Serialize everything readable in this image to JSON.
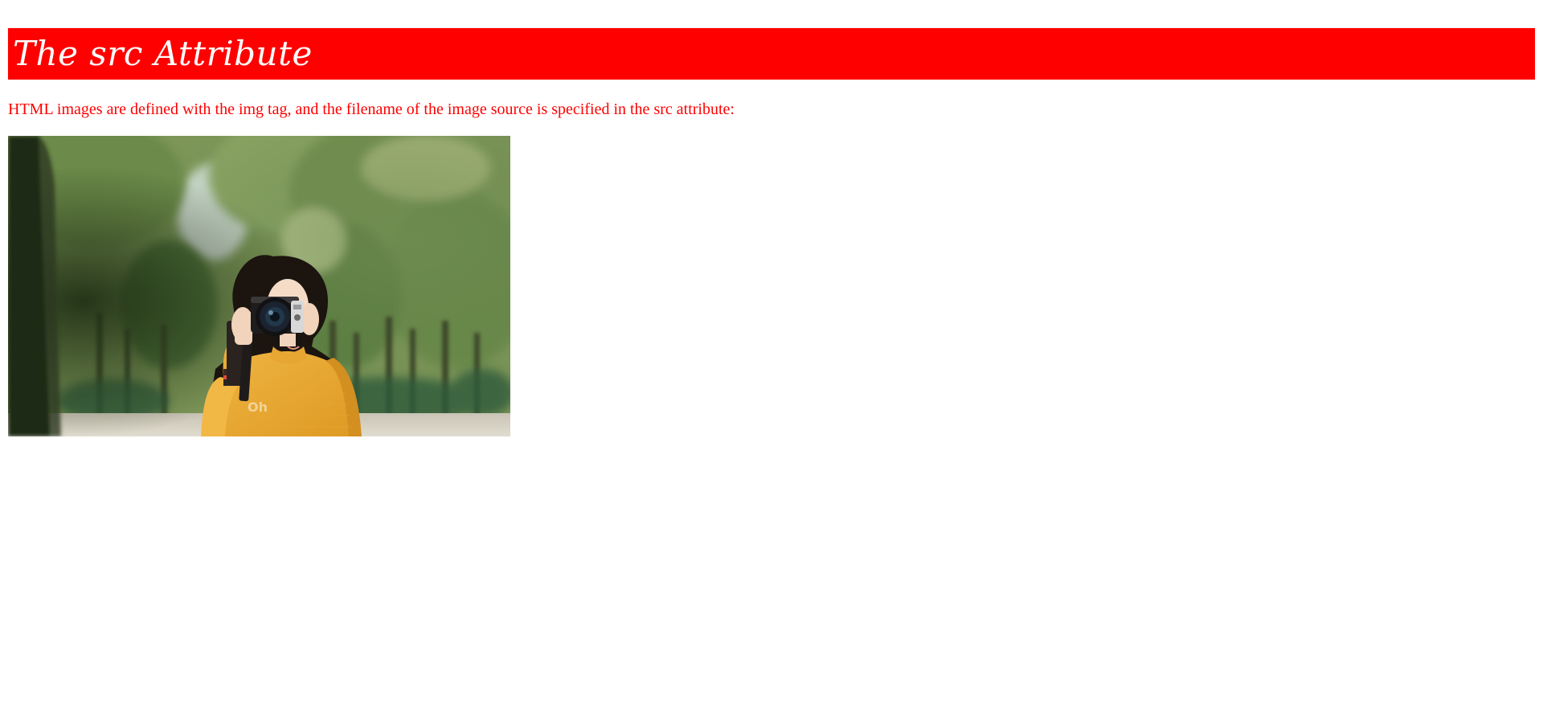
{
  "banner": {
    "title": "The src Attribute",
    "background_color": "#ff0000",
    "text_color": "#ffffff"
  },
  "intro": {
    "text": "HTML images are defined with the img tag, and the filename of the image source is specified in the src attribute:",
    "text_color": "#ff0000"
  },
  "photo": {
    "icon": "photo-of-woman-with-camera-icon",
    "sweater_print": "Oh"
  }
}
